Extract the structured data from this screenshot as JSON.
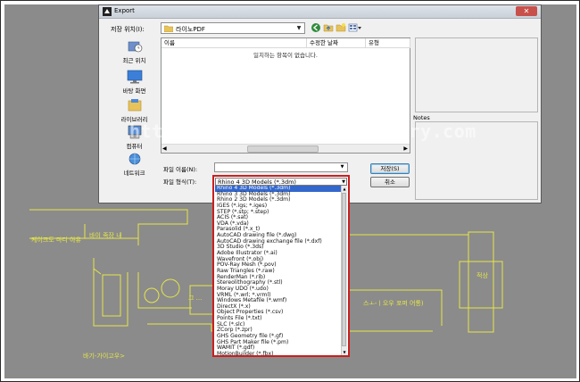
{
  "dialog": {
    "title": "Export",
    "save_in_label": "저장 위치(I):",
    "save_in_value": "라이노PDF"
  },
  "places": [
    {
      "label": "최근 위치",
      "icon": "recent-places-icon"
    },
    {
      "label": "바탕 화면",
      "icon": "desktop-icon"
    },
    {
      "label": "라이브러리",
      "icon": "libraries-icon"
    },
    {
      "label": "컴퓨터",
      "icon": "computer-icon"
    },
    {
      "label": "네트워크",
      "icon": "network-icon"
    }
  ],
  "file_list": {
    "columns": [
      "이름",
      "수정한 날짜",
      "유형"
    ],
    "empty_message": "일치하는 항목이 없습니다."
  },
  "notes_label": "Notes",
  "file_name_label": "파일 이름(N):",
  "file_type_label": "파일 형식(T):",
  "save_button": "저장(S)",
  "cancel_button": "취소",
  "file_type_selected": "Rhino 4 3D Models (*.3dm)",
  "file_type_options": [
    "Rhino 4 3D Models (*.3dm)",
    "Rhino 3 3D Models (*.3dm)",
    "Rhino 2 3D Models (*.3dm)",
    "IGES (*.igs; *.iges)",
    "STEP (*.stp; *.step)",
    "ACIS (*.sat)",
    "VDA (*.vda)",
    "Parasolid (*.x_t)",
    "AutoCAD drawing file (*.dwg)",
    "AutoCAD drawing exchange file (*.dxf)",
    "3D Studio (*.3ds)",
    "Adobe Illustrator (*.ai)",
    "Wavefront (*.obj)",
    "POV-Ray Mesh (*.pov)",
    "Raw Triangles (*.raw)",
    "RenderMan (*.rib)",
    "Stereolithography (*.stl)",
    "Moray UDO (*.udo)",
    "VRML (*.wrl; *.vrml)",
    "Windows Metafile (*.wmf)",
    "DirectX (*.x)",
    "Object Properties (*.csv)",
    "Points File (*.txt)",
    "SLC (*.slc)",
    "ZCorp (*.zpr)",
    "GHS Geometry file (*.gf)",
    "GHS Part Maker file (*.pm)",
    "WAMIT (*.gdf)",
    "MotionBuilder (*.fbx)",
    "XGL (*.xgl)"
  ],
  "highlighted_index": 0,
  "cad_labels": {
    "label_1": "케이크도 마디 아유",
    "label_2": "바이 족장 내",
    "label_3": "적상",
    "label_4": "스ㅗ-ㅣ오우 포퍼 어통)",
    "label_5": "바기-가이고우>",
    "label_6": "그 ..."
  },
  "watermark": "http://themecreator.tistory.com",
  "colors": {
    "background": "#8b8b8b",
    "cad_lines": "#e6e64a",
    "highlight": "#3367cc",
    "dropdown_border": "#cc1e1e"
  }
}
